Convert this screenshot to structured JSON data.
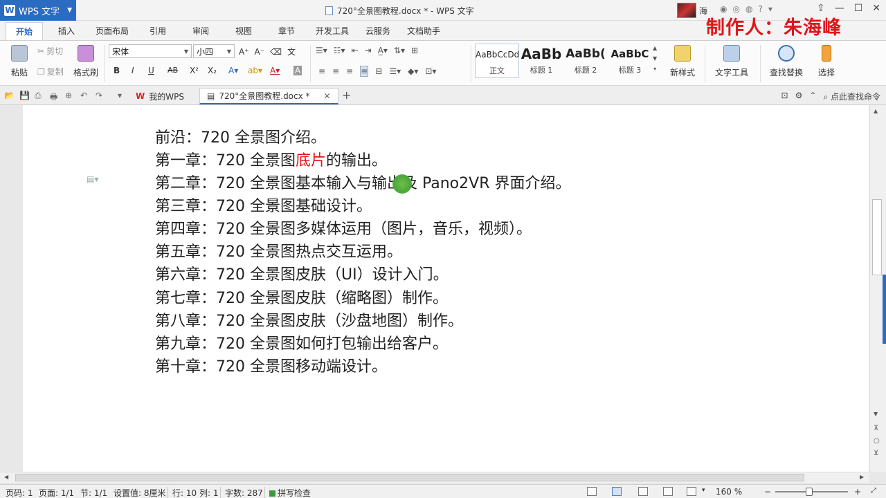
{
  "titlebar": {
    "app_name": "WPS 文字",
    "document_title": "720°全景图教程.docx * - WPS 文字",
    "user_short": "海",
    "maker_overlay": "制作人：朱海峰"
  },
  "menu": {
    "tabs": [
      "开始",
      "插入",
      "页面布局",
      "引用",
      "审阅",
      "视图",
      "章节",
      "开发工具",
      "云服务",
      "文档助手"
    ],
    "active": "开始"
  },
  "ribbon": {
    "clipboard": {
      "paste": "粘贴",
      "cut": "剪切",
      "copy": "复制",
      "format_painter": "格式刷"
    },
    "font_name": "宋体",
    "font_size": "小四",
    "styles": [
      {
        "sample": "AaBbCcDd",
        "label": "正文"
      },
      {
        "sample": "AaBb",
        "label": "标题 1"
      },
      {
        "sample": "AaBb(",
        "label": "标题 2"
      },
      {
        "sample": "AaBbC",
        "label": "标题 3"
      }
    ],
    "new_style": "新样式",
    "text_tools": "文字工具",
    "find_replace": "查找替换",
    "select": "选择",
    "format_buttons": {
      "bold": "B",
      "italic": "I",
      "underline": "U",
      "strike": "AB",
      "superscript": "X²",
      "subscript": "X₂"
    }
  },
  "tabbar": {
    "my_wps": "我的WPS",
    "doc_tab": "720°全景图教程.docx *",
    "search_command": "点此查找命令"
  },
  "document": {
    "lines": [
      {
        "text": "前沿：720 全景图介绍。"
      },
      {
        "prefix": "第一章：720 全景图",
        "red": "底片",
        "suffix": "的输出。"
      },
      {
        "text": "第二章：720 全景图基本输入与输出及 Pano2VR 界面介绍。"
      },
      {
        "text": "第三章：720 全景图基础设计。"
      },
      {
        "text": "第四章：720 全景图多媒体运用（图片，音乐，视频）。"
      },
      {
        "text": "第五章：720 全景图热点交互运用。"
      },
      {
        "text": "第六章：720 全景图皮肤（UI）设计入门。"
      },
      {
        "text": "第七章：720 全景图皮肤（缩略图）制作。"
      },
      {
        "text": "第八章：720 全景图皮肤（沙盘地图）制作。"
      },
      {
        "text": "第九章：720 全景图如何打包输出给客户。"
      },
      {
        "text": "第十章：720 全景图移动端设计。"
      }
    ],
    "highlight_color": "#e0151b"
  },
  "statusbar": {
    "page_no": "页码: 1",
    "pages": "页面: 1/1",
    "section": "节: 1/1",
    "setting": "设置值: 8厘米",
    "row": "行: 10",
    "col": "列: 1",
    "word_count": "字数: 287",
    "spell_check": "拼写检查",
    "zoom": "160 %"
  },
  "colors": {
    "accent": "#2b6cc2",
    "maker_red": "#e0151b"
  }
}
